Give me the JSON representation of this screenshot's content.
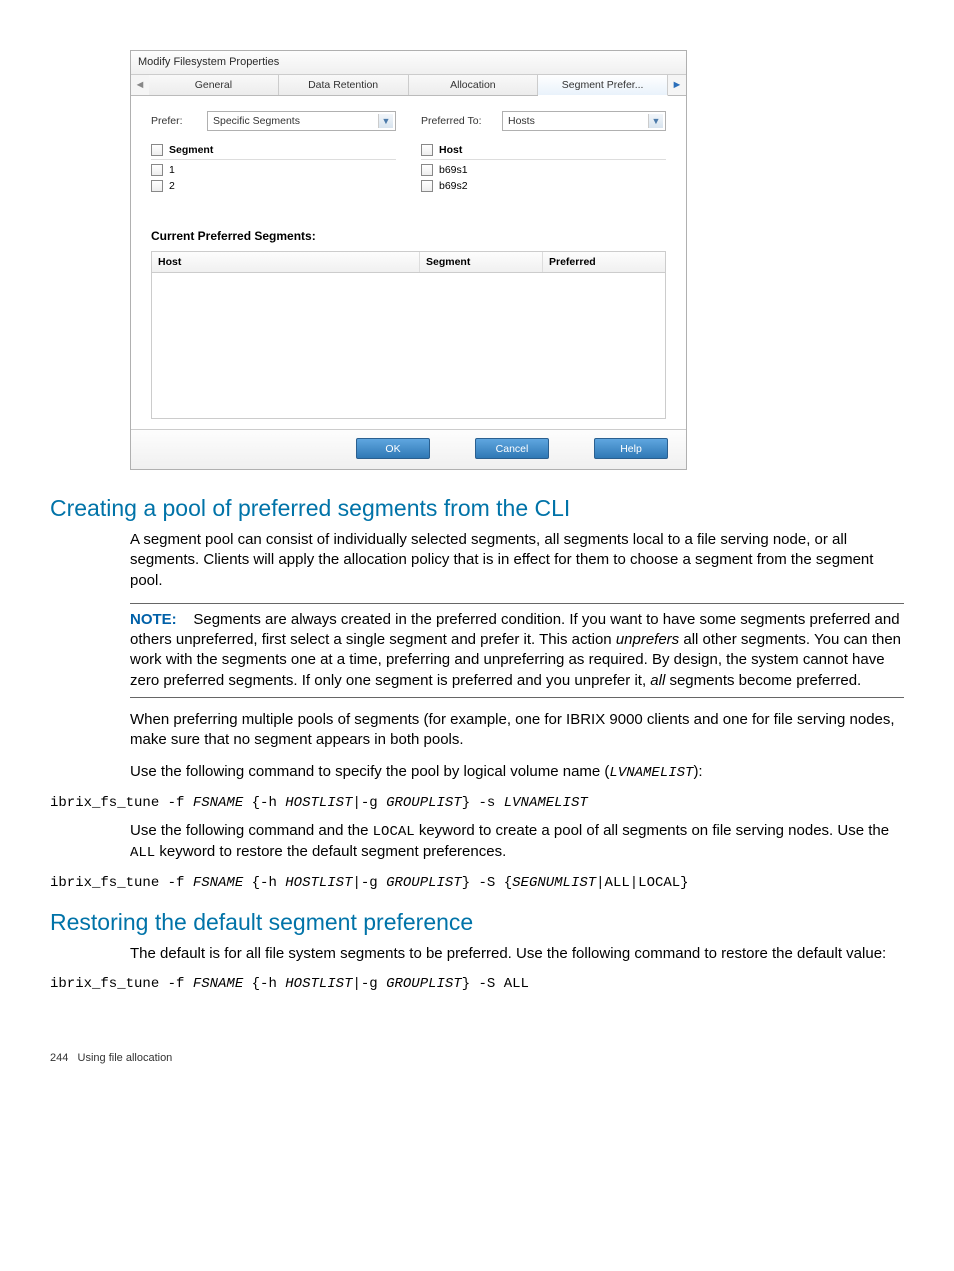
{
  "dialog": {
    "title": "Modify Filesystem Properties",
    "tabs": [
      "General",
      "Data Retention",
      "Allocation",
      "Segment Prefer..."
    ],
    "prefer_label": "Prefer:",
    "prefer_value": "Specific Segments",
    "preferred_to_label": "Preferred To:",
    "preferred_to_value": "Hosts",
    "segment_list": {
      "header": "Segment",
      "items": [
        "1",
        "2"
      ]
    },
    "host_list": {
      "header": "Host",
      "items": [
        "b69s1",
        "b69s2"
      ]
    },
    "cps_title": "Current Preferred Segments:",
    "grid": {
      "h1": "Host",
      "h2": "Segment",
      "h3": "Preferred"
    },
    "buttons": {
      "ok": "OK",
      "cancel": "Cancel",
      "help": "Help"
    }
  },
  "section1": {
    "heading": "Creating a pool of preferred segments from the CLI",
    "para1": "A segment pool can consist of individually selected segments, all segments local to a file serving node, or all segments. Clients will apply the allocation policy that is in effect for them to choose a segment from the segment pool.",
    "note_label": "NOTE:",
    "note_a": "Segments are always created in the preferred condition. If you want to have some segments preferred and others unpreferred, first select a single segment and prefer it. This action ",
    "note_b": "unprefers",
    "note_c": " all other segments. You can then work with the segments one at a time, preferring and unpreferring as required. By design, the system cannot have zero preferred segments. If only one segment is preferred and you unprefer it, ",
    "note_d": "all",
    "note_e": " segments become preferred.",
    "para2": "When preferring multiple pools of segments (for example, one for IBRIX 9000 clients and one for file serving nodes, make sure that no segment appears in both pools.",
    "para3a": "Use the following command to specify the pool by logical volume name (",
    "para3b": "LVNAMELIST",
    "para3c": "):",
    "cmd1_a": "ibrix_fs_tune -f ",
    "cmd1_b": "FSNAME",
    "cmd1_c": " {-h ",
    "cmd1_d": "HOSTLIST",
    "cmd1_e": "|-g ",
    "cmd1_f": "GROUPLIST",
    "cmd1_g": "} -s ",
    "cmd1_h": "LVNAMELIST",
    "para4a": "Use the following command and the ",
    "para4b": "LOCAL",
    "para4c": " keyword to create a pool of all segments on file serving nodes. Use the ",
    "para4d": "ALL",
    "para4e": " keyword to restore the default segment preferences.",
    "cmd2_a": "ibrix_fs_tune -f ",
    "cmd2_b": "FSNAME",
    "cmd2_c": " {-h ",
    "cmd2_d": "HOSTLIST",
    "cmd2_e": "|-g ",
    "cmd2_f": "GROUPLIST",
    "cmd2_g": "} -S {",
    "cmd2_h": "SEGNUMLIST",
    "cmd2_i": "|ALL|LOCAL}"
  },
  "section2": {
    "heading": "Restoring the default segment preference",
    "para1": "The default is for all file system segments to be preferred. Use the following command to restore the default value:",
    "cmd_a": "ibrix_fs_tune -f ",
    "cmd_b": "FSNAME",
    "cmd_c": " {-h ",
    "cmd_d": "HOSTLIST",
    "cmd_e": "|-g ",
    "cmd_f": "GROUPLIST",
    "cmd_g": "} -S ALL"
  },
  "footer": {
    "page": "244",
    "section": "Using file allocation"
  }
}
